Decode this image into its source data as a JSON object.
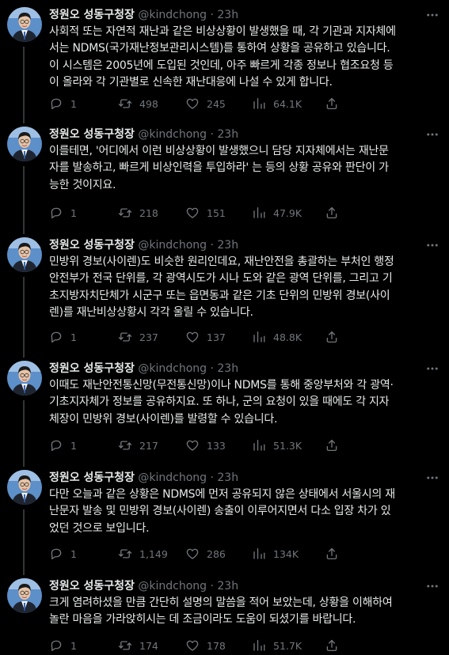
{
  "author": {
    "name": "정원오 성동구청장",
    "handle": "@kindchong",
    "separator": "·"
  },
  "colors": {
    "background": "#000000",
    "text": "#e7e9ea",
    "muted": "#71767b",
    "thread_line": "#333639"
  },
  "icons": [
    "reply-icon",
    "retweet-icon",
    "like-icon",
    "views-icon",
    "share-icon",
    "more-icon"
  ],
  "tweets": [
    {
      "time": "23h",
      "text": "사회적 또는 자연적 재난과 같은 비상상황이 발생했을 때, 각 기관과 지자체에\n서는 NDMS(국가재난정보관리시스템)를 통하여 상황을 공유하고 있습니다.\n이 시스템은 2005년에 도입된 것인데, 아주 빠르게 각종 정보나 협조요청 등\n이 올라와 각 기관별로 신속한 재난대응에 나설 수 있게 합니다.",
      "replies": "1",
      "retweets": "498",
      "likes": "245",
      "views": "64.1K"
    },
    {
      "time": "23h",
      "text": "이를테면, '어디에서 이런 비상상황이 발생했으니 담당 지자체에서는 재난문\n자를 발송하고, 빠르게 비상인력을 투입하라' 는 등의 상황 공유와 판단이 가\n능한 것이지요.",
      "replies": "1",
      "retweets": "218",
      "likes": "151",
      "views": "47.9K"
    },
    {
      "time": "23h",
      "text": "민방위 경보(사이렌)도 비슷한 원리인데요, 재난안전을 총괄하는 부처인 행정\n안전부가 전국 단위를, 각 광역시도가 시나 도와 같은 광역 단위를, 그리고 기\n초지방자치단체가 시군구 또는 읍면동과 같은 기초 단위의 민방위 경보(사이\n렌)를 재난비상상황시 각각 울릴 수 있습니다.",
      "replies": "1",
      "retweets": "237",
      "likes": "137",
      "views": "48.8K"
    },
    {
      "time": "23h",
      "text": "이때도 재난안전통신망(무전통신망)이나 NDMS를 통해 중앙부처와 각 광역·\n기초지자체가 정보를 공유하지요. 또 하나, 군의 요청이 있을 때에도 각 지자\n체장이 민방위 경보(사이렌)를 발령할 수 있습니다.",
      "replies": "1",
      "retweets": "217",
      "likes": "133",
      "views": "51.3K"
    },
    {
      "time": "23h",
      "text": "다만 오늘과 같은 상황은 NDMS에 먼저 공유되지 않은 상태에서 서울시의 재\n난문자 발송 및 민방위 경보(사이렌) 송출이 이루어지면서 다소 입장 차가 있\n었던 것으로 보입니다.",
      "replies": "1",
      "retweets": "1,149",
      "likes": "286",
      "views": "134K"
    },
    {
      "time": "23h",
      "text": "크게 염려하셨을 만큼 간단히 설명의 말씀을 적어 보았는데, 상황을 이해하여\n놀란 마음을 가라앉히시는 데 조금이라도 도움이 되셨기를 바랍니다.",
      "replies": "1",
      "retweets": "174",
      "likes": "178",
      "views": "51.7K"
    }
  ]
}
